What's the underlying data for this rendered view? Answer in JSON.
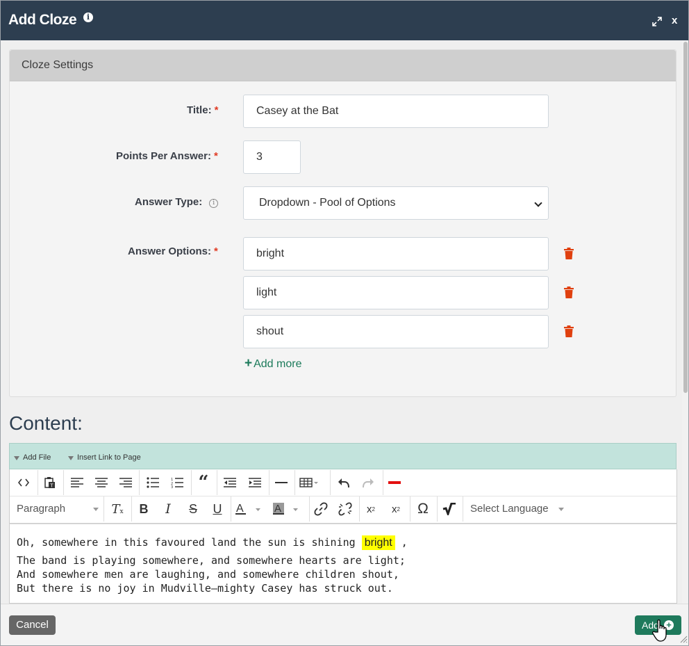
{
  "header": {
    "title": "Add Cloze",
    "close_label": "x"
  },
  "settings": {
    "heading": "Cloze Settings",
    "title_label": "Title:",
    "title_value": "Casey at the Bat",
    "points_label": "Points Per Answer:",
    "points_value": "3",
    "answer_type_label": "Answer Type:",
    "answer_type_value": "Dropdown - Pool of Options",
    "answer_options_label": "Answer Options:",
    "answer_options": [
      "bright",
      "light",
      "shout"
    ],
    "add_more_label": "Add more",
    "required_mark": "*"
  },
  "content": {
    "heading": "Content:",
    "bar": {
      "add_file": "Add File",
      "insert_link": "Insert Link to Page"
    },
    "toolbar": {
      "format_select": "Paragraph",
      "language_select": "Select Language"
    },
    "editor": {
      "line1_before": "Oh, somewhere in this favoured land the sun is shining",
      "line1_highlight": "bright",
      "line1_after": ",",
      "line2": "The band is playing somewhere, and somewhere hearts are light;",
      "line3": "And somewhere men are laughing, and somewhere children shout,",
      "line4": "But there is no joy in Mudville—mighty Casey has struck out."
    }
  },
  "footer": {
    "cancel_label": "Cancel",
    "add_label": "Add"
  },
  "colors": {
    "header_bg": "#2d3e50",
    "primary_green": "#1f7a5c",
    "danger": "#e03b24",
    "highlight": "#ffff00"
  }
}
